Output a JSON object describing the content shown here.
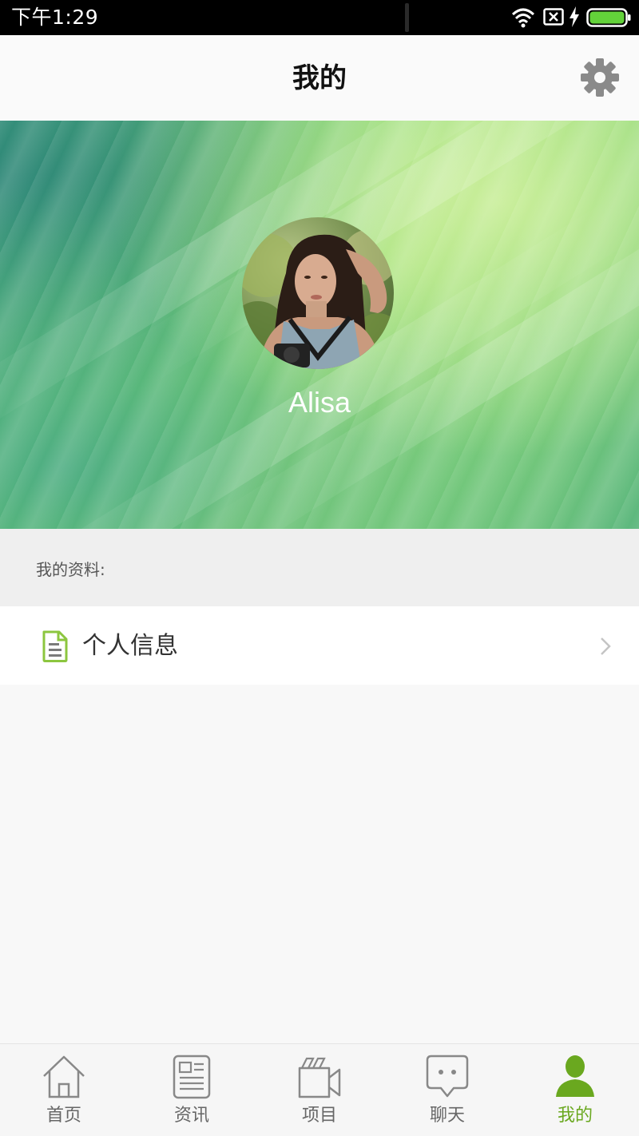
{
  "status_bar": {
    "time": "下午1:29"
  },
  "header": {
    "title": "我的"
  },
  "profile": {
    "username": "Alisa"
  },
  "section": {
    "label": "我的资料:"
  },
  "menu": {
    "personal_info_label": "个人信息"
  },
  "bottom_nav": {
    "tabs": [
      {
        "label": "首页",
        "icon": "home-icon",
        "active": false
      },
      {
        "label": "资讯",
        "icon": "news-icon",
        "active": false
      },
      {
        "label": "项目",
        "icon": "video-icon",
        "active": false
      },
      {
        "label": "聊天",
        "icon": "chat-icon",
        "active": false
      },
      {
        "label": "我的",
        "icon": "user-icon",
        "active": true
      }
    ]
  },
  "colors": {
    "accent": "#6aa81f",
    "doc_icon": "#8cc63f",
    "nav_inactive": "#888888"
  }
}
